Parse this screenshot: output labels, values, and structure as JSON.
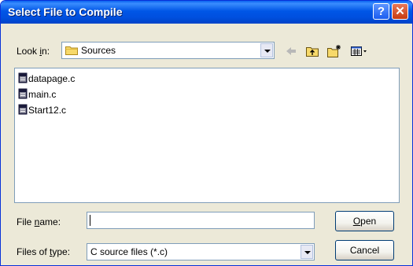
{
  "window": {
    "title": "Select File to Compile"
  },
  "lookin": {
    "label_pre": "Look ",
    "label_key": "i",
    "label_post": "n:",
    "value": "Sources"
  },
  "toolbar": [
    "back-icon",
    "up-folder-icon",
    "new-folder-icon",
    "views-menu-icon"
  ],
  "files": [
    {
      "name": "datapage.c",
      "icon": "c-source-file-icon"
    },
    {
      "name": "main.c",
      "icon": "c-source-file-icon"
    },
    {
      "name": "Start12.c",
      "icon": "c-source-file-icon"
    }
  ],
  "filename": {
    "label_pre": "File ",
    "label_key": "n",
    "label_post": "ame:",
    "value": ""
  },
  "filetype": {
    "label_pre": "Files of ",
    "label_key": "t",
    "label_post": "ype:",
    "value": "C source files (*.c)"
  },
  "buttons": {
    "open_key": "O",
    "open_rest": "pen",
    "cancel": "Cancel"
  },
  "colors": {
    "titlebar": "#0054e3",
    "dialog": "#ece9d8",
    "border": "#7f9db9"
  }
}
